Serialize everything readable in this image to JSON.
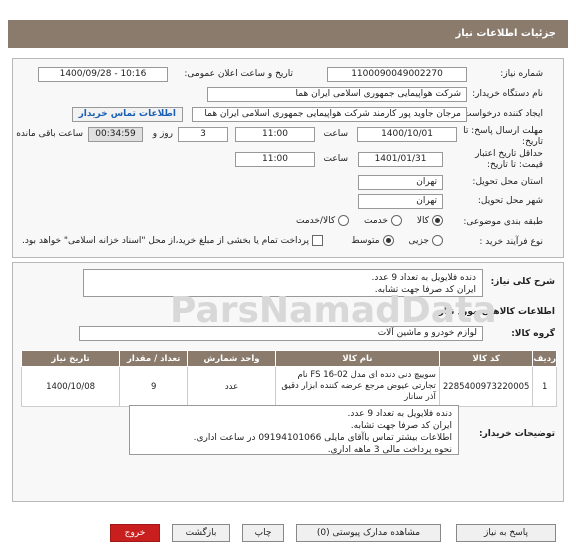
{
  "header": {
    "title": "جزئیات اطلاعات نیاز"
  },
  "form": {
    "need_number_label": "شماره نیاز:",
    "need_number": "1100090049002270",
    "announce_label": "تاریخ و ساعت اعلان عمومی:",
    "announce_value": "1400/09/28 - 10:16",
    "buyer_label": "نام دستگاه خریدار:",
    "buyer_value": "شرکت هواپیمایی جمهوری اسلامی ایران هما",
    "creator_label": "ایجاد کننده درخواست:",
    "creator_value": "مرجان جاوید پور کارمند شرکت هواپیمایی جمهوری اسلامی ایران هما",
    "contact_link": "اطلاعات تماس خریدار",
    "deadline_label": "مهلت ارسال پاسخ: تا تاریخ:",
    "deadline_date": "1400/10/01",
    "time_label": "ساعت",
    "deadline_time": "11:00",
    "days_value": "3",
    "days_label": "روز و",
    "remaining_value": "00:34:59",
    "remaining_label": "ساعت باقی مانده",
    "validity_label": "حداقل تاریخ اعتبار قیمت: تا تاریخ:",
    "validity_date": "1401/01/31",
    "validity_time": "11:00",
    "province_label": "استان محل تحویل:",
    "province_value": "تهران",
    "city_label": "شهر محل تحویل:",
    "city_value": "تهران",
    "category_label": "طبقه بندی موضوعی:",
    "category_options": [
      "کالا",
      "خدمت",
      "کالا/خدمت"
    ],
    "process_label": "نوع فرآیند خرید :",
    "process_options": [
      "جزیی",
      "متوسط"
    ],
    "process_note": "پرداخت تمام یا بخشی از مبلغ خرید،از محل \"اسناد خزانه اسلامی\" خواهد بود."
  },
  "details": {
    "summary_label": "شرح کلی نیاز:",
    "summary_line1": "دنده فلایویل  به تعداد 9 عدد.",
    "summary_line2": "ایران کد صرفا جهت تشابه.",
    "goods_title": "اطلاعات کالاهای مورد نیاز",
    "group_label": "گروه کالا:",
    "group_value": "لوازم خودرو و ماشین آلات",
    "table": {
      "headers": [
        "ردیف",
        "کد کالا",
        "نام کالا",
        "واحد شمارش",
        "تعداد / مقدار",
        "تاریخ نیاز"
      ],
      "rows": [
        {
          "row": "1",
          "code": "2285400973220005",
          "name": "سوییچ دنی دنده ای مدل FS 16-02 نام تجارتی عیوض مرجع عرضه کننده ابزار دقیق آذر سانار",
          "unit": "عدد",
          "qty": "9",
          "date": "1400/10/08"
        }
      ]
    },
    "notes_label": "توضیحات خریدار:",
    "notes_lines": [
      "دنده فلایویل  به تعداد 9 عدد.",
      "ایران کد صرفا جهت تشابه.",
      "اطلاعات بیشتر تماس باآقای مایلی 09194101066 در ساعت اداری.",
      "نحوه پرداخت مالی 3 ماهه اداری."
    ]
  },
  "buttons": {
    "reply": "پاسخ به نیاز",
    "attachments": "مشاهده مدارک پیوستی (0)",
    "print": "چاپ",
    "back": "بازگشت",
    "exit": "خروج"
  },
  "watermark": "ParsNamadData"
}
